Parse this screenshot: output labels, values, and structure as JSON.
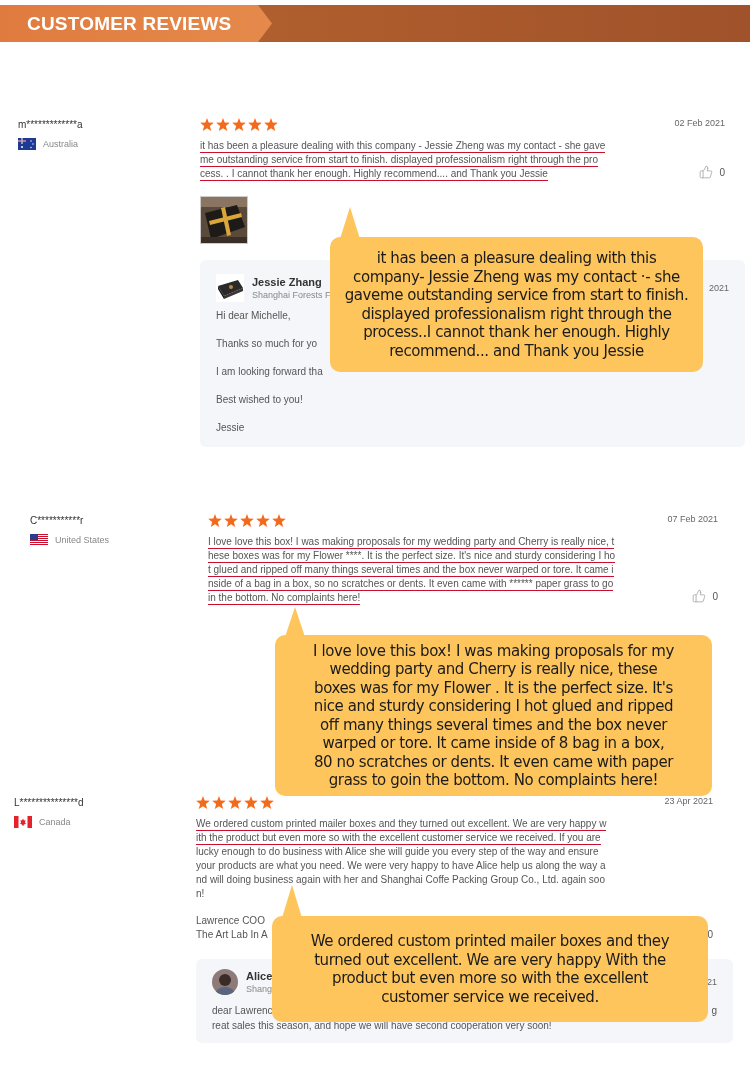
{
  "header": {
    "title": "CUSTOMER REVIEWS"
  },
  "reviews": [
    {
      "user": "m*************a",
      "country": "Australia",
      "stars": 5,
      "date": "02 Feb 2021",
      "likes": "0",
      "like_icon": true,
      "lines": [
        {
          "text": "it has been a pleasure dealing with this company - Jessie Zheng was my contact - she gave",
          "underlined": true
        },
        {
          "text": "me outstanding service from start to finish. displayed professionalism right through the pro",
          "underlined": true
        },
        {
          "text": "cess. . I cannot thank her enough. Highly recommend.... and Thank you Jessie",
          "underlined": true
        }
      ],
      "photos": [
        {
          "kind": "picture"
        }
      ],
      "reply": {
        "avatar": {
          "kind": "picture"
        },
        "name": "Jessie Zhang",
        "company": "Shanghai Forests F",
        "date": "2021",
        "paragraphs": [
          [
            [
              "Hi dear Michelle,"
            ]
          ],
          [
            [
              "Thanks so much for yo"
            ]
          ],
          [
            [
              "I am looking forward tha"
            ]
          ],
          [
            [
              "Best wished to you!"
            ]
          ],
          [
            [
              "Jessie"
            ]
          ]
        ]
      }
    },
    {
      "user": "C***********r",
      "country": "United States",
      "stars": 5,
      "date": "07 Feb 2021",
      "likes": "0",
      "like_icon": true,
      "lines": [
        {
          "text": "I love love this box! I was making proposals for my wedding party and Cherry is really nice, t",
          "underlined": true
        },
        {
          "text": "hese boxes was for my Flower ****. It is the perfect size. It's nice and sturdy considering I ho",
          "underlined": true
        },
        {
          "text": "t glued and ripped off many things several times and the box never warped or tore. It came i",
          "underlined": true
        },
        {
          "text": "nside of a bag in a box, so no scratches or dents. It even came with ****** paper grass to go",
          "underlined": true
        },
        {
          "text": "in the bottom. No complaints here!",
          "underlined": true
        }
      ]
    },
    {
      "user": "L***************d",
      "country": "Canada",
      "stars": 5,
      "date": "23 Apr 2021",
      "likes": "0",
      "like_icon": false,
      "lines": [
        {
          "text": "We ordered custom printed mailer boxes and they turned out excellent. We are very happy w",
          "underlined": true
        },
        {
          "text": "ith the product but even more so with the excellent customer service we received. If you are",
          "underlined": true
        },
        {
          "text": "lucky enough to do business with Alice she will guide you every step of the way and ensure",
          "underlined": false
        },
        {
          "text": "your products are what you need. We were very happy to have Alice help us along the way a",
          "underlined": false
        },
        {
          "text": "nd will doing business again with her and Shanghai Coffe Packing Group Co., Ltd. again soo",
          "underlined": false
        },
        {
          "text": "n!",
          "underlined": false
        }
      ],
      "signature": [
        "Lawrence COO",
        "The Art Lab In A"
      ],
      "reply": {
        "avatar": {
          "kind": "person"
        },
        "name": "Alice",
        "company": "Shang",
        "date": "21",
        "paragraphs": [
          [
            [
              "dear Lawrenc",
              "g"
            ],
            [
              "reat sales this season, and hope we will have second cooperation very soon!"
            ]
          ]
        ]
      }
    }
  ],
  "callouts": [
    {
      "lines": [
        "it has been a pleasure dealing with this",
        "company- Jessie Zheng was my contact ·- she",
        "gaveme outstanding service from start to finish.",
        "displayed professionalism right through the",
        "process..I cannot thank her enough. Highly",
        "recommend... and Thank you Jessie"
      ]
    },
    {
      "lines": [
        "I love love this box! I was making proposals for my",
        "wedding party and Cherry is really nice, these",
        "boxes was for my Flower . It is the perfect size. It's",
        "nice and sturdy considering I hot glued and ripped",
        "off many things several times and the box never",
        "warped or tore. It came inside of 8 bag in a box,",
        "80 no scratches or dents. It even came with paper",
        "grass to goin the bottom. No complaints here!"
      ]
    },
    {
      "lines": [
        "We ordered custom printed mailer boxes and they",
        "turned out excellent. We are very happy With the",
        "product but even more so with the excellent",
        "customer service we received."
      ]
    }
  ]
}
